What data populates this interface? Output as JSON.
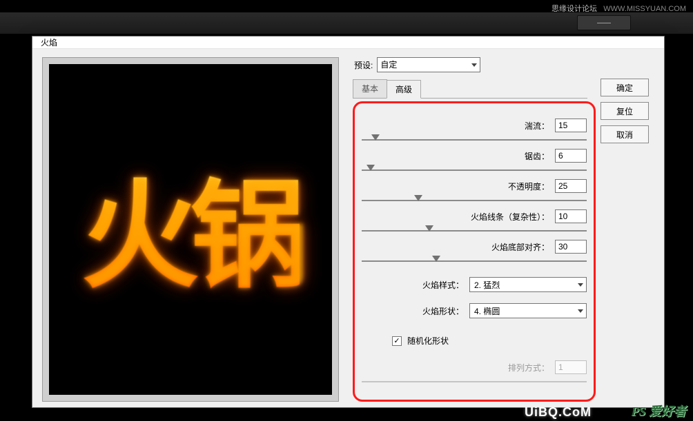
{
  "page_watermark_zh": "思缘设计论坛",
  "page_watermark_url": "WWW.MISSYUAN.COM",
  "editor_tab_label": "——",
  "dialog": {
    "title": "火焰",
    "preview_text": "火锅",
    "preset_label": "预设:",
    "preset_value": "自定",
    "tabs": {
      "basic": "基本",
      "advanced": "高级"
    },
    "params": {
      "turbulence": {
        "label": "湍流：",
        "value": "15",
        "pos_pct": 6
      },
      "jagged": {
        "label": "锯齿：",
        "value": "6",
        "pos_pct": 4
      },
      "opacity": {
        "label": "不透明度：",
        "value": "25",
        "pos_pct": 25
      },
      "complexity": {
        "label": "火焰线条（复杂性）：",
        "value": "10",
        "pos_pct": 30
      },
      "bottom_align": {
        "label": "火焰底部对齐：",
        "value": "30",
        "pos_pct": 33
      }
    },
    "style_label": "火焰样式：",
    "style_value": "2. 猛烈",
    "shape_label": "火焰形状：",
    "shape_value": "4. 椭圆",
    "randomize_label": "随机化形状",
    "randomize_checked": "✓",
    "arrange_label": "排列方式：",
    "arrange_value": "1",
    "buttons": {
      "ok": "确定",
      "reset": "复位",
      "cancel": "取消"
    }
  },
  "bottom_wm_ps": "PS 爱好者",
  "bottom_wm_uibq": "UiBQ.CoM"
}
